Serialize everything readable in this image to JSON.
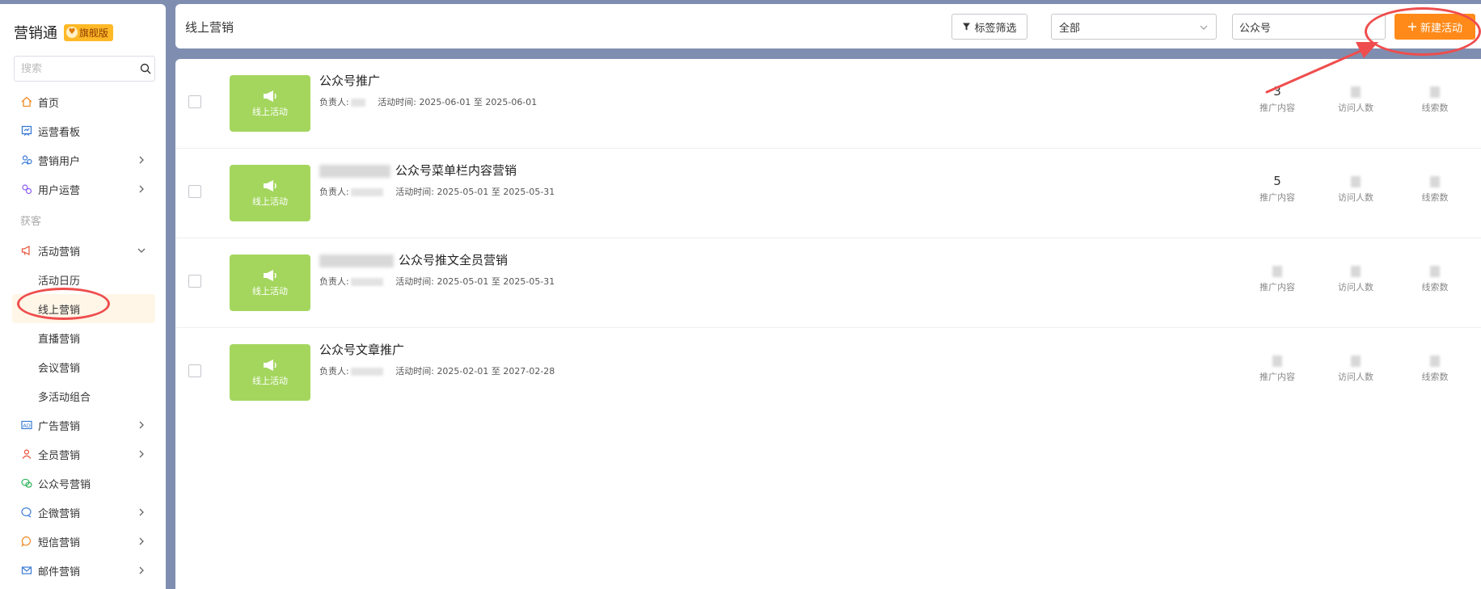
{
  "sidebar": {
    "brand_title": "营销通",
    "badge_label": "旗舰版",
    "search_placeholder": "搜索",
    "items": [
      {
        "label": "首页",
        "icon": "home-icon"
      },
      {
        "label": "运营看板",
        "icon": "dashboard-icon"
      },
      {
        "label": "营销用户",
        "icon": "users-icon"
      },
      {
        "label": "用户运营",
        "icon": "user-ops-icon"
      }
    ],
    "group_label": "获客",
    "activity_marketing": "活动营销",
    "sub_items": [
      "活动日历",
      "线上营销",
      "直播营销",
      "会议营销",
      "多活动组合"
    ],
    "bottom_items": [
      {
        "label": "广告营销",
        "icon": "ad-icon"
      },
      {
        "label": "全员营销",
        "icon": "team-icon"
      },
      {
        "label": "公众号营销",
        "icon": "wechat-icon"
      },
      {
        "label": "企微营销",
        "icon": "wecom-icon"
      },
      {
        "label": "短信营销",
        "icon": "sms-icon"
      },
      {
        "label": "邮件营销",
        "icon": "mail-icon"
      }
    ]
  },
  "header": {
    "title": "线上营销",
    "tag_filter_label": "标签筛选",
    "select_value": "全部",
    "keyword_value": "公众号",
    "new_button_label": "新建活动"
  },
  "thumb_label": "线上活动",
  "meta": {
    "owner_label": "负责人:",
    "time_label": "活动时间:",
    "to": "至"
  },
  "stat_labels": [
    "推广内容",
    "访问人数",
    "线索数"
  ],
  "rows": [
    {
      "title": "公众号推广",
      "start": "2025-06-01",
      "end": "2025-06-01",
      "promo": "3"
    },
    {
      "title": "公众号菜单栏内容营销",
      "start": "2025-05-01",
      "end": "2025-05-31",
      "promo": "5"
    },
    {
      "title": "公众号推文全员营销",
      "start": "2025-05-01",
      "end": "2025-05-31",
      "promo": ""
    },
    {
      "title": "公众号文章推广",
      "start": "2025-02-01",
      "end": "2027-02-28",
      "promo": ""
    }
  ],
  "colors": {
    "accent": "#ff8a1a",
    "thumb": "#a4d65e",
    "annotation": "#ef4d4d",
    "page_bg": "#7f8eb0"
  }
}
